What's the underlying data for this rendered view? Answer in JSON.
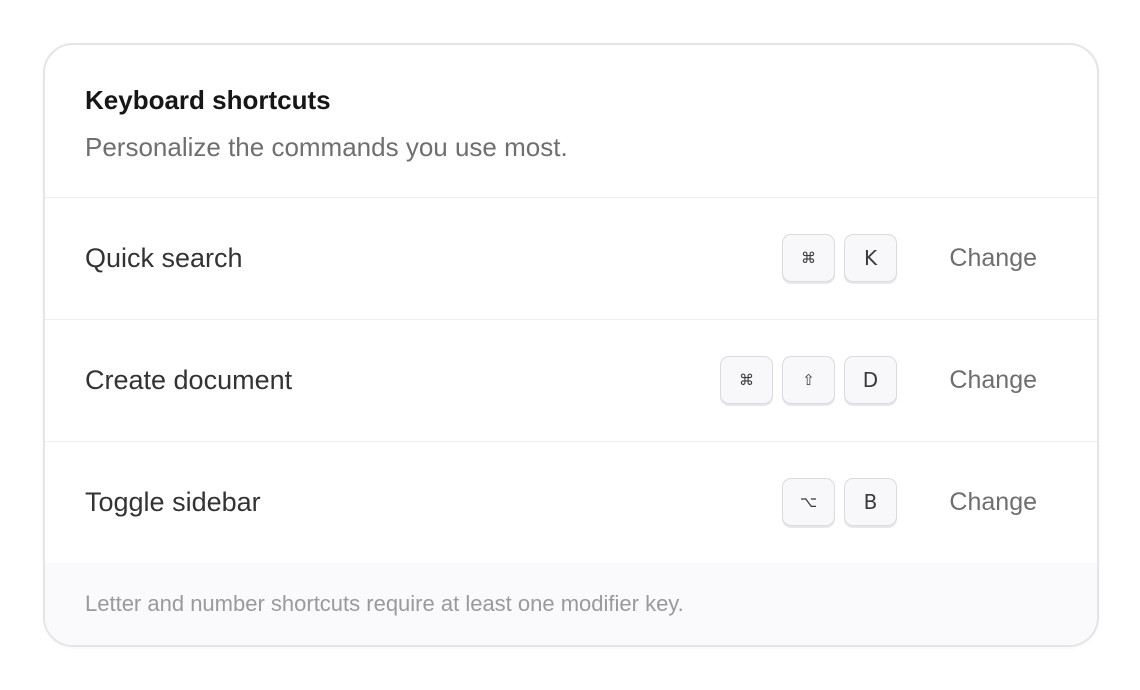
{
  "header": {
    "title": "Keyboard shortcuts",
    "subtitle": "Personalize the commands you use most."
  },
  "shortcuts": [
    {
      "label": "Quick search",
      "keys": [
        {
          "symbol": "⌘",
          "icon": "command-key-icon"
        },
        {
          "symbol": "K"
        }
      ],
      "action": "Change"
    },
    {
      "label": "Create document",
      "keys": [
        {
          "symbol": "⌘",
          "icon": "command-key-icon"
        },
        {
          "symbol": "⇧",
          "icon": "shift-key-icon"
        },
        {
          "symbol": "D"
        }
      ],
      "action": "Change"
    },
    {
      "label": "Toggle sidebar",
      "keys": [
        {
          "symbol": "⌥",
          "icon": "option-key-icon"
        },
        {
          "symbol": "B"
        }
      ],
      "action": "Change"
    }
  ],
  "footer": {
    "note": "Letter and number shortcuts require at least one modifier key."
  }
}
